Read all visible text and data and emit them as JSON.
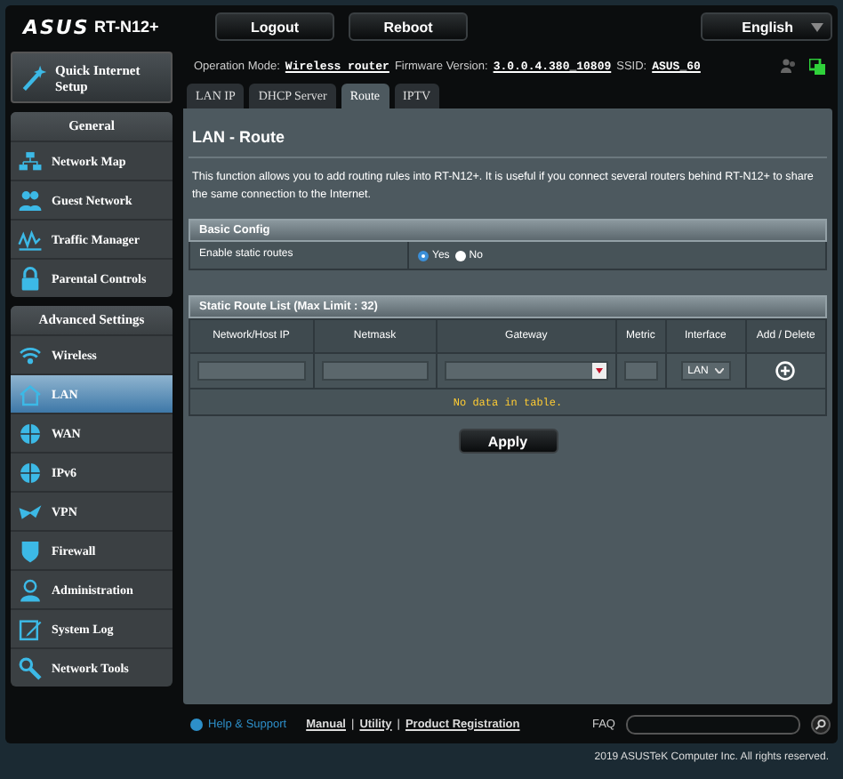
{
  "header": {
    "logo": "ASUS",
    "model": "RT-N12+",
    "buttons": [
      "Logout",
      "Reboot"
    ],
    "language": "English"
  },
  "quick_setup": "Quick Internet Setup",
  "status": {
    "mode_label": "Operation Mode:",
    "mode": "Wireless router",
    "firmware_label": "Firmware Version:",
    "firmware": "3.0.0.4.380_10809",
    "ssid_label": "SSID:",
    "ssid": "ASUS_60"
  },
  "sidebar": [
    {
      "title": "General",
      "items": [
        {
          "label": "Network Map",
          "selected": false
        },
        {
          "label": "Guest Network",
          "selected": false
        },
        {
          "label": "Traffic Manager",
          "selected": false
        },
        {
          "label": "Parental Controls",
          "selected": false
        }
      ]
    },
    {
      "title": "Advanced Settings",
      "items": [
        {
          "label": "Wireless",
          "selected": false
        },
        {
          "label": "LAN",
          "selected": true
        },
        {
          "label": "WAN",
          "selected": false
        },
        {
          "label": "IPv6",
          "selected": false
        },
        {
          "label": "VPN",
          "selected": false
        },
        {
          "label": "Firewall",
          "selected": false
        },
        {
          "label": "Administration",
          "selected": false
        },
        {
          "label": "System Log",
          "selected": false
        },
        {
          "label": "Network Tools",
          "selected": false
        }
      ]
    }
  ],
  "tabs": [
    {
      "label": "LAN IP",
      "selected": false
    },
    {
      "label": "DHCP Server",
      "selected": false
    },
    {
      "label": "Route",
      "selected": true
    },
    {
      "label": "IPTV",
      "selected": false
    }
  ],
  "page_title": "LAN - Route",
  "description": "This function allows you to add routing rules into RT-N12+. It is useful if you connect several routers behind RT-N12+ to share the same connection to the Internet.",
  "basic_config": {
    "title": "Basic Config",
    "label": "Enable static routes",
    "options": [
      {
        "label": "Yes",
        "selected": true
      },
      {
        "label": "No",
        "selected": false
      }
    ]
  },
  "route_list": {
    "title": "Static Route List (Max Limit : 32)",
    "columns": [
      "Network/Host IP",
      "Netmask",
      "Gateway",
      "Metric",
      "Interface",
      "Add / Delete"
    ],
    "interface": "LAN",
    "empty": "No data in table."
  },
  "apply": "Apply",
  "footer": {
    "help": "Help & Support",
    "links": [
      "Manual",
      "Utility",
      "Product Registration"
    ],
    "separator": "|",
    "faq": "FAQ",
    "copyright": "2019 ASUSTeK Computer Inc. All rights reserved."
  }
}
